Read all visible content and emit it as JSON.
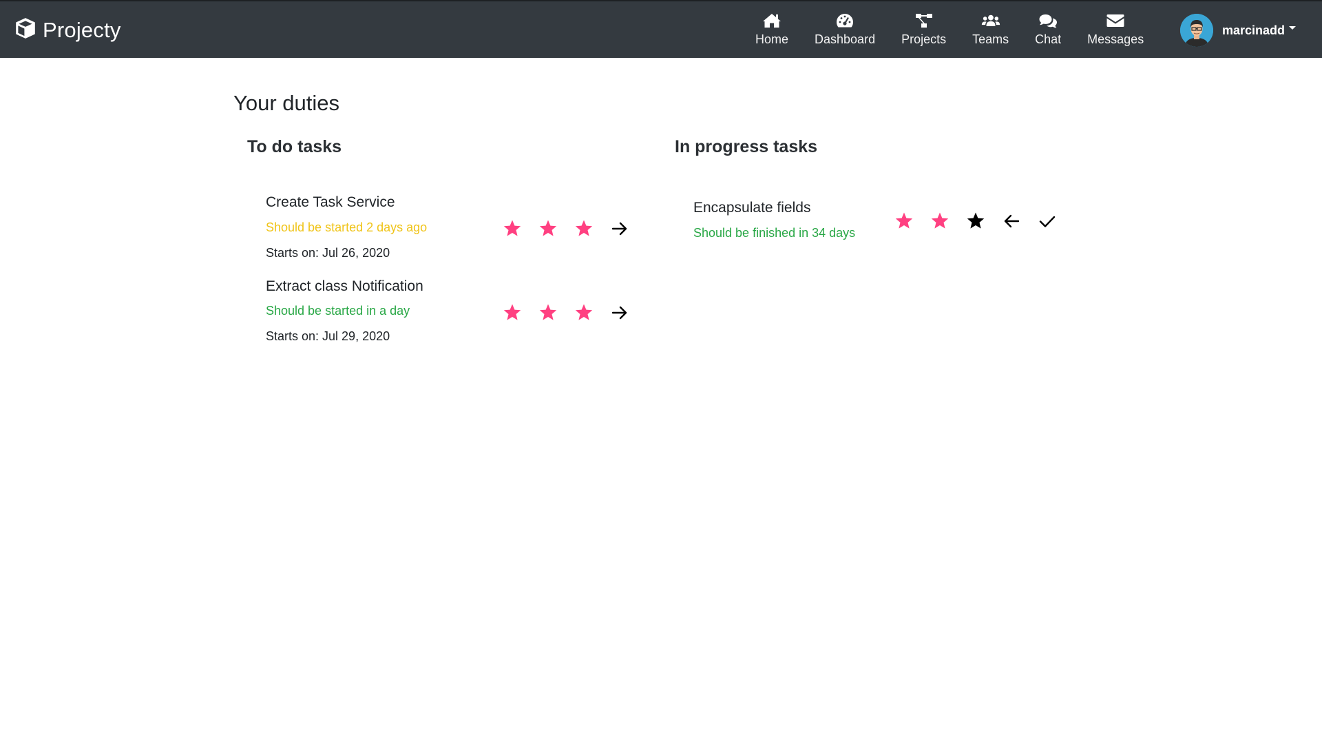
{
  "brand": {
    "name": "Projecty",
    "icon": "cube-icon"
  },
  "nav": {
    "items": [
      {
        "label": "Home",
        "icon": "home-icon"
      },
      {
        "label": "Dashboard",
        "icon": "dashboard-gauge-icon"
      },
      {
        "label": "Projects",
        "icon": "project-diagram-icon"
      },
      {
        "label": "Teams",
        "icon": "users-icon"
      },
      {
        "label": "Chat",
        "icon": "comments-icon"
      },
      {
        "label": "Messages",
        "icon": "envelope-icon"
      }
    ]
  },
  "user": {
    "name": "marcinadd"
  },
  "page": {
    "title": "Your duties"
  },
  "todo": {
    "title": "To do tasks",
    "tasks": [
      {
        "name": "Create Task Service",
        "status": "Should be started 2 days ago",
        "status_kind": "warning",
        "start": "Starts on: Jul 26, 2020",
        "priority_filled": 3,
        "priority_max": 3
      },
      {
        "name": "Extract class Notification",
        "status": "Should be started in a day",
        "status_kind": "success",
        "start": "Starts on: Jul 29, 2020",
        "priority_filled": 3,
        "priority_max": 3
      }
    ]
  },
  "in_progress": {
    "title": "In progress tasks",
    "tasks": [
      {
        "name": "Encapsulate fields",
        "status": "Should be finished in 34 days",
        "status_kind": "success",
        "priority_filled": 2,
        "priority_max": 3
      }
    ]
  },
  "colors": {
    "navbar": "#343a40",
    "star_filled": "#ff4081",
    "star_empty": "#000000",
    "warning": "#f0c419",
    "success": "#28a745"
  }
}
